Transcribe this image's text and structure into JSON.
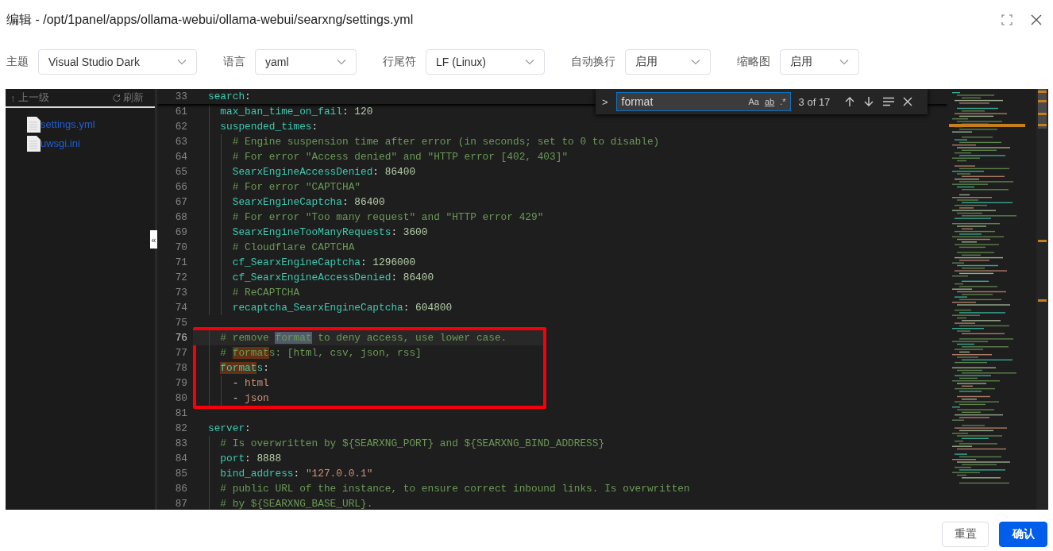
{
  "dialog": {
    "title": "编辑 - /opt/1panel/apps/ollama-webui/ollama-webui/searxng/settings.yml"
  },
  "toolbar": [
    {
      "label": "主题",
      "value": "Visual Studio Dark"
    },
    {
      "label": "语言",
      "value": "yaml"
    },
    {
      "label": "行尾符",
      "value": "LF (Linux)"
    },
    {
      "label": "自动换行",
      "value": "启用"
    },
    {
      "label": "缩略图",
      "value": "启用"
    }
  ],
  "file_panel": {
    "up_glyph": "↑",
    "up_label": "上一级",
    "refresh_label": "刷新",
    "collapse_glyph": "«",
    "files": [
      {
        "name": "settings.yml"
      },
      {
        "name": "uwsgi.ini"
      }
    ]
  },
  "find_widget": {
    "expand_glyph": ">",
    "value": "format",
    "toggles": [
      {
        "label": "Aa",
        "on": false
      },
      {
        "label": "ab",
        "on": false
      },
      {
        "label": ".*",
        "on": false
      }
    ],
    "count": "3 of 17"
  },
  "editor": {
    "sticky": {
      "number": "33",
      "tokens": [
        {
          "kind": "key",
          "text": "search"
        },
        {
          "kind": "punct",
          "text": ":"
        }
      ]
    },
    "lines": [
      {
        "number": "61",
        "current": false,
        "annotated": false,
        "tokens": [
          {
            "kind": "key",
            "text": "  max_ban_time_on_fail"
          },
          {
            "kind": "punct",
            "text": ": "
          },
          {
            "kind": "num",
            "text": "120"
          }
        ]
      },
      {
        "number": "62",
        "current": false,
        "annotated": false,
        "tokens": [
          {
            "kind": "key",
            "text": "  suspended_times"
          },
          {
            "kind": "punct",
            "text": ":"
          }
        ]
      },
      {
        "number": "63",
        "current": false,
        "annotated": false,
        "tokens": [
          {
            "kind": "comment",
            "text": "    # Engine suspension time after error (in seconds; set to 0 to disable)"
          }
        ]
      },
      {
        "number": "64",
        "current": false,
        "annotated": false,
        "tokens": [
          {
            "kind": "comment",
            "text": "    # For error \"Access denied\" and \"HTTP error [402, 403]\""
          }
        ]
      },
      {
        "number": "65",
        "current": false,
        "annotated": false,
        "tokens": [
          {
            "kind": "key",
            "text": "    SearxEngineAccessDenied"
          },
          {
            "kind": "punct",
            "text": ": "
          },
          {
            "kind": "num",
            "text": "86400"
          }
        ]
      },
      {
        "number": "66",
        "current": false,
        "annotated": false,
        "tokens": [
          {
            "kind": "comment",
            "text": "    # For error \"CAPTCHA\""
          }
        ]
      },
      {
        "number": "67",
        "current": false,
        "annotated": false,
        "tokens": [
          {
            "kind": "key",
            "text": "    SearxEngineCaptcha"
          },
          {
            "kind": "punct",
            "text": ": "
          },
          {
            "kind": "num",
            "text": "86400"
          }
        ]
      },
      {
        "number": "68",
        "current": false,
        "annotated": false,
        "tokens": [
          {
            "kind": "comment",
            "text": "    # For error \"Too many request\" and \"HTTP error 429\""
          }
        ]
      },
      {
        "number": "69",
        "current": false,
        "annotated": false,
        "tokens": [
          {
            "kind": "key",
            "text": "    SearxEngineTooManyRequests"
          },
          {
            "kind": "punct",
            "text": ": "
          },
          {
            "kind": "num",
            "text": "3600"
          }
        ]
      },
      {
        "number": "70",
        "current": false,
        "annotated": false,
        "tokens": [
          {
            "kind": "comment",
            "text": "    # Cloudflare CAPTCHA"
          }
        ]
      },
      {
        "number": "71",
        "current": false,
        "annotated": false,
        "tokens": [
          {
            "kind": "key",
            "text": "    cf_SearxEngineCaptcha"
          },
          {
            "kind": "punct",
            "text": ": "
          },
          {
            "kind": "num",
            "text": "1296000"
          }
        ]
      },
      {
        "number": "72",
        "current": false,
        "annotated": false,
        "tokens": [
          {
            "kind": "key",
            "text": "    cf_SearxEngineAccessDenied"
          },
          {
            "kind": "punct",
            "text": ": "
          },
          {
            "kind": "num",
            "text": "86400"
          }
        ]
      },
      {
        "number": "73",
        "current": false,
        "annotated": false,
        "tokens": [
          {
            "kind": "comment",
            "text": "    # ReCAPTCHA"
          }
        ]
      },
      {
        "number": "74",
        "current": false,
        "annotated": false,
        "tokens": [
          {
            "kind": "key",
            "text": "    recaptcha_SearxEngineCaptcha"
          },
          {
            "kind": "punct",
            "text": ": "
          },
          {
            "kind": "num",
            "text": "604800"
          }
        ]
      },
      {
        "number": "75",
        "current": false,
        "annotated": false
      },
      {
        "number": "76",
        "current": true,
        "annotated": true,
        "tokens": [
          {
            "kind": "comment",
            "text": "  # remove "
          },
          {
            "kind": "comment",
            "text": "format",
            "match": true,
            "selected": true
          },
          {
            "kind": "comment",
            "text": " to deny access, use lower case."
          }
        ]
      },
      {
        "number": "77",
        "current": false,
        "annotated": true,
        "tokens": [
          {
            "kind": "comment",
            "text": "  # "
          },
          {
            "kind": "comment",
            "text": "format",
            "match": true,
            "selected": false
          },
          {
            "kind": "comment",
            "text": "s: [html, csv, json, rss]"
          }
        ]
      },
      {
        "number": "78",
        "current": false,
        "annotated": true,
        "tokens": [
          {
            "kind": "key",
            "text": "  format",
            "match": true,
            "selected": false
          },
          {
            "kind": "key",
            "text": "s"
          },
          {
            "kind": "punct",
            "text": ":"
          }
        ]
      },
      {
        "number": "79",
        "current": false,
        "annotated": true,
        "tokens": [
          {
            "kind": "punct",
            "text": "    - "
          },
          {
            "kind": "str",
            "text": "html"
          }
        ]
      },
      {
        "number": "80",
        "current": false,
        "annotated": true,
        "tokens": [
          {
            "kind": "punct",
            "text": "    - "
          },
          {
            "kind": "str",
            "text": "json"
          }
        ]
      },
      {
        "number": "81",
        "current": false,
        "annotated": false
      },
      {
        "number": "82",
        "current": false,
        "annotated": false,
        "tokens": [
          {
            "kind": "key",
            "text": "server"
          },
          {
            "kind": "punct",
            "text": ":"
          }
        ]
      },
      {
        "number": "83",
        "current": false,
        "annotated": false,
        "tokens": [
          {
            "kind": "comment",
            "text": "  # Is overwritten by ${SEARXNG_PORT} and ${SEARXNG_BIND_ADDRESS}"
          }
        ]
      },
      {
        "number": "84",
        "current": false,
        "annotated": false,
        "tokens": [
          {
            "kind": "key",
            "text": "  port"
          },
          {
            "kind": "punct",
            "text": ": "
          },
          {
            "kind": "num",
            "text": "8888"
          }
        ]
      },
      {
        "number": "85",
        "current": false,
        "annotated": false,
        "tokens": [
          {
            "kind": "key",
            "text": "  bind_address"
          },
          {
            "kind": "punct",
            "text": ": "
          },
          {
            "kind": "str",
            "text": "\"127.0.0.1\""
          }
        ]
      },
      {
        "number": "86",
        "current": false,
        "annotated": false,
        "tokens": [
          {
            "kind": "comment",
            "text": "  # public URL of the instance, to ensure correct inbound links. Is overwritten"
          }
        ]
      },
      {
        "number": "87",
        "current": false,
        "annotated": false,
        "tokens": [
          {
            "kind": "comment",
            "text": "  # by ${SEARXNG_BASE_URL}."
          }
        ]
      }
    ]
  },
  "buttons": [
    {
      "label": "重置",
      "kind": "secondary"
    },
    {
      "label": "确认",
      "kind": "primary"
    }
  ]
}
